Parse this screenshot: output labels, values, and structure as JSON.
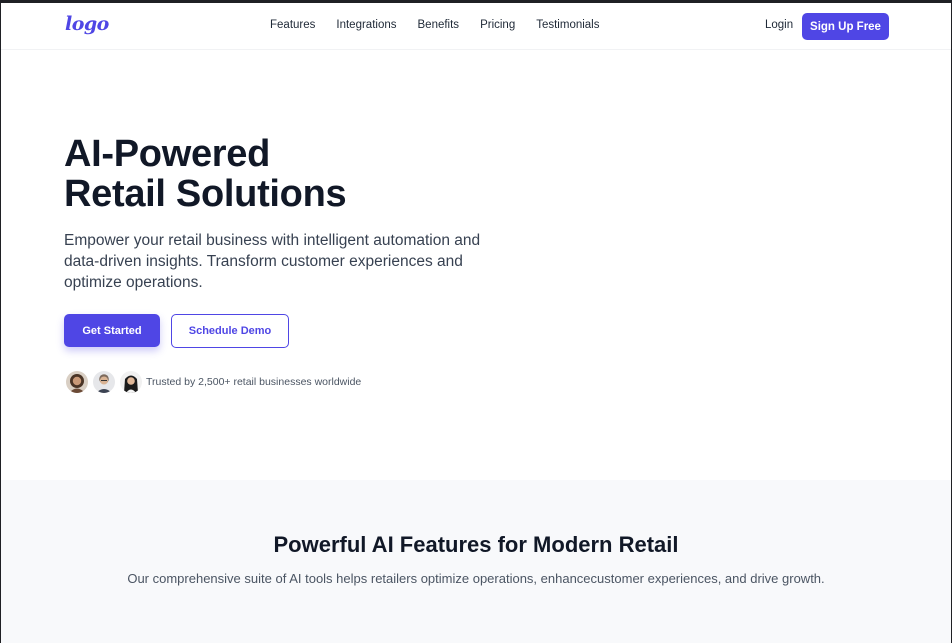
{
  "header": {
    "logo": "logo",
    "nav": [
      "Features",
      "Integrations",
      "Benefits",
      "Pricing",
      "Testimonials"
    ],
    "login": "Login",
    "signup": "Sign Up Free"
  },
  "hero": {
    "title_line1": "AI-Powered",
    "title_line2": "Retail Solutions",
    "description": "Empower your retail business with intelligent automation and data-driven insights. Transform customer experiences and optimize operations.",
    "primary_cta": "Get Started",
    "secondary_cta": "Schedule Demo",
    "trust_text": "Trusted by 2,500+ retail businesses worldwide"
  },
  "features": {
    "title": "Powerful AI Features for Modern Retail",
    "subtitle": "Our comprehensive suite of AI tools helps retailers optimize operations, enhancecustomer experiences, and drive growth."
  },
  "colors": {
    "accent": "#4f46e5",
    "text_dark": "#111827",
    "section_bg": "#f8f9fb"
  }
}
